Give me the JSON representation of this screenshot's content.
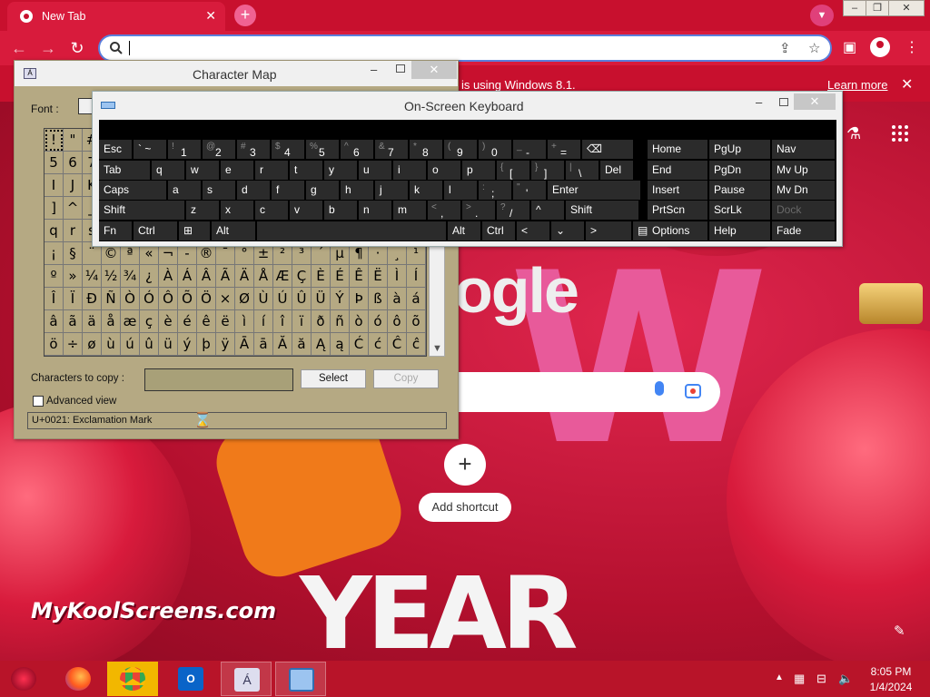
{
  "browser": {
    "tab_title": "New Tab",
    "tab_close": "✕",
    "new_tab": "+",
    "infobar_message": "r is using Windows 8.1.",
    "infobar_link": "Learn more",
    "new_tab_page": {
      "logo_partial": "ogle",
      "add_shortcut_label": "Add shortcut",
      "add_shortcut_plus": "+"
    }
  },
  "watermark": "MyKoolScreens.com",
  "charmap": {
    "title": "Character Map",
    "font_label": "Font :",
    "characters_to_copy_label": "Characters to copy :",
    "characters_to_copy_value": "",
    "select_button": "Select",
    "copy_button": "Copy",
    "advanced_view_label": "Advanced view",
    "advanced_view_checked": false,
    "status": "U+0021: Exclamation Mark",
    "grid_rows": [
      [
        "!",
        "\"",
        "#",
        "",
        "",
        "",
        "",
        "",
        "",
        "",
        "",
        "",
        "",
        "",
        "",
        "",
        "",
        "",
        "",
        ""
      ],
      [
        "5",
        "6",
        "7",
        "",
        "",
        "",
        "",
        "",
        "",
        "",
        "",
        "",
        "",
        "",
        "",
        "",
        "",
        "",
        "",
        ""
      ],
      [
        "I",
        "J",
        "K",
        "",
        "",
        "",
        "",
        "",
        "",
        "",
        "",
        "",
        "",
        "",
        "",
        "",
        "",
        "",
        "",
        ""
      ],
      [
        "]",
        "^",
        "_",
        "",
        "",
        "",
        "",
        "",
        "",
        "",
        "",
        "",
        "",
        "",
        "",
        "",
        "",
        "",
        "",
        ""
      ],
      [
        "q",
        "r",
        "s",
        "",
        "",
        "",
        "",
        "",
        "",
        "",
        "",
        "",
        "",
        "",
        "",
        "",
        "",
        "",
        "",
        ""
      ],
      [
        "¡",
        "§",
        "¨",
        "©",
        "ª",
        "«",
        "¬",
        "-",
        "®",
        "¯",
        "°",
        "±",
        "²",
        "³",
        "´",
        "µ",
        "¶",
        "·",
        "¸",
        "¹"
      ],
      [
        "º",
        "»",
        "¼",
        "½",
        "¾",
        "¿",
        "À",
        "Á",
        "Â",
        "Ã",
        "Ä",
        "Å",
        "Æ",
        "Ç",
        "È",
        "É",
        "Ê",
        "Ë",
        "Ì",
        "Í"
      ],
      [
        "Î",
        "Ï",
        "Ð",
        "Ñ",
        "Ò",
        "Ó",
        "Ô",
        "Õ",
        "Ö",
        "×",
        "Ø",
        "Ù",
        "Ú",
        "Û",
        "Ü",
        "Ý",
        "Þ",
        "ß",
        "à",
        "á"
      ],
      [
        "â",
        "ã",
        "ä",
        "å",
        "æ",
        "ç",
        "è",
        "é",
        "ê",
        "ë",
        "ì",
        "í",
        "î",
        "ï",
        "ð",
        "ñ",
        "ò",
        "ó",
        "ô",
        "õ"
      ],
      [
        "ö",
        "÷",
        "ø",
        "ù",
        "ú",
        "û",
        "ü",
        "ý",
        "þ",
        "ÿ",
        "Ā",
        "ā",
        "Ă",
        "ă",
        "Ą",
        "ą",
        "Ć",
        "ć",
        "Ĉ",
        "ĉ"
      ]
    ]
  },
  "osk": {
    "title": "On-Screen Keyboard",
    "row1": [
      {
        "main": "Esc"
      },
      {
        "main": "` ~",
        "sub": ""
      },
      {
        "main": "1",
        "sub": "!"
      },
      {
        "main": "2",
        "sub": "@"
      },
      {
        "main": "3",
        "sub": "#"
      },
      {
        "main": "4",
        "sub": "$"
      },
      {
        "main": "5",
        "sub": "%"
      },
      {
        "main": "6",
        "sub": "^"
      },
      {
        "main": "7",
        "sub": "&"
      },
      {
        "main": "8",
        "sub": "*"
      },
      {
        "main": "9",
        "sub": "("
      },
      {
        "main": "0",
        "sub": ")"
      },
      {
        "main": "-",
        "sub": "_"
      },
      {
        "main": "=",
        "sub": "+"
      },
      {
        "main": "⌫"
      }
    ],
    "row2": [
      {
        "main": "Tab"
      },
      {
        "main": "q"
      },
      {
        "main": "w"
      },
      {
        "main": "e"
      },
      {
        "main": "r"
      },
      {
        "main": "t"
      },
      {
        "main": "y"
      },
      {
        "main": "u"
      },
      {
        "main": "i"
      },
      {
        "main": "o"
      },
      {
        "main": "p"
      },
      {
        "main": "[",
        "sub": "{"
      },
      {
        "main": "]",
        "sub": "}"
      },
      {
        "main": "\\",
        "sub": "|"
      },
      {
        "main": "Del"
      }
    ],
    "row3": [
      {
        "main": "Caps"
      },
      {
        "main": "a"
      },
      {
        "main": "s"
      },
      {
        "main": "d"
      },
      {
        "main": "f"
      },
      {
        "main": "g"
      },
      {
        "main": "h"
      },
      {
        "main": "j"
      },
      {
        "main": "k"
      },
      {
        "main": "l"
      },
      {
        "main": ";",
        "sub": ":"
      },
      {
        "main": "'",
        "sub": "\""
      },
      {
        "main": "Enter"
      }
    ],
    "row4": [
      {
        "main": "Shift"
      },
      {
        "main": "z"
      },
      {
        "main": "x"
      },
      {
        "main": "c"
      },
      {
        "main": "v"
      },
      {
        "main": "b"
      },
      {
        "main": "n"
      },
      {
        "main": "m"
      },
      {
        "main": ",",
        "sub": "<"
      },
      {
        "main": ".",
        "sub": ">"
      },
      {
        "main": "/",
        "sub": "?"
      },
      {
        "main": "^"
      },
      {
        "main": "Shift"
      }
    ],
    "row5": [
      {
        "main": "Fn"
      },
      {
        "main": "Ctrl"
      },
      {
        "main": "⊞"
      },
      {
        "main": "Alt"
      },
      {
        "main": ""
      },
      {
        "main": "Alt"
      },
      {
        "main": "Ctrl"
      },
      {
        "main": "<"
      },
      {
        "main": "⌄"
      },
      {
        "main": ">"
      },
      {
        "main": "▤"
      }
    ],
    "nav_keys": [
      [
        "Home",
        "PgUp",
        "Nav"
      ],
      [
        "End",
        "PgDn",
        "Mv Up"
      ],
      [
        "Insert",
        "Pause",
        "Mv Dn"
      ],
      [
        "PrtScn",
        "ScrLk",
        "Dock"
      ],
      [
        "Options",
        "Help",
        "Fade"
      ]
    ]
  },
  "taskbar": {
    "time": "8:05 PM",
    "date": "1/4/2024",
    "apps": [
      "firefox-icon",
      "chrome-icon",
      "outlook-icon",
      "charmap-icon",
      "osk-icon"
    ]
  }
}
